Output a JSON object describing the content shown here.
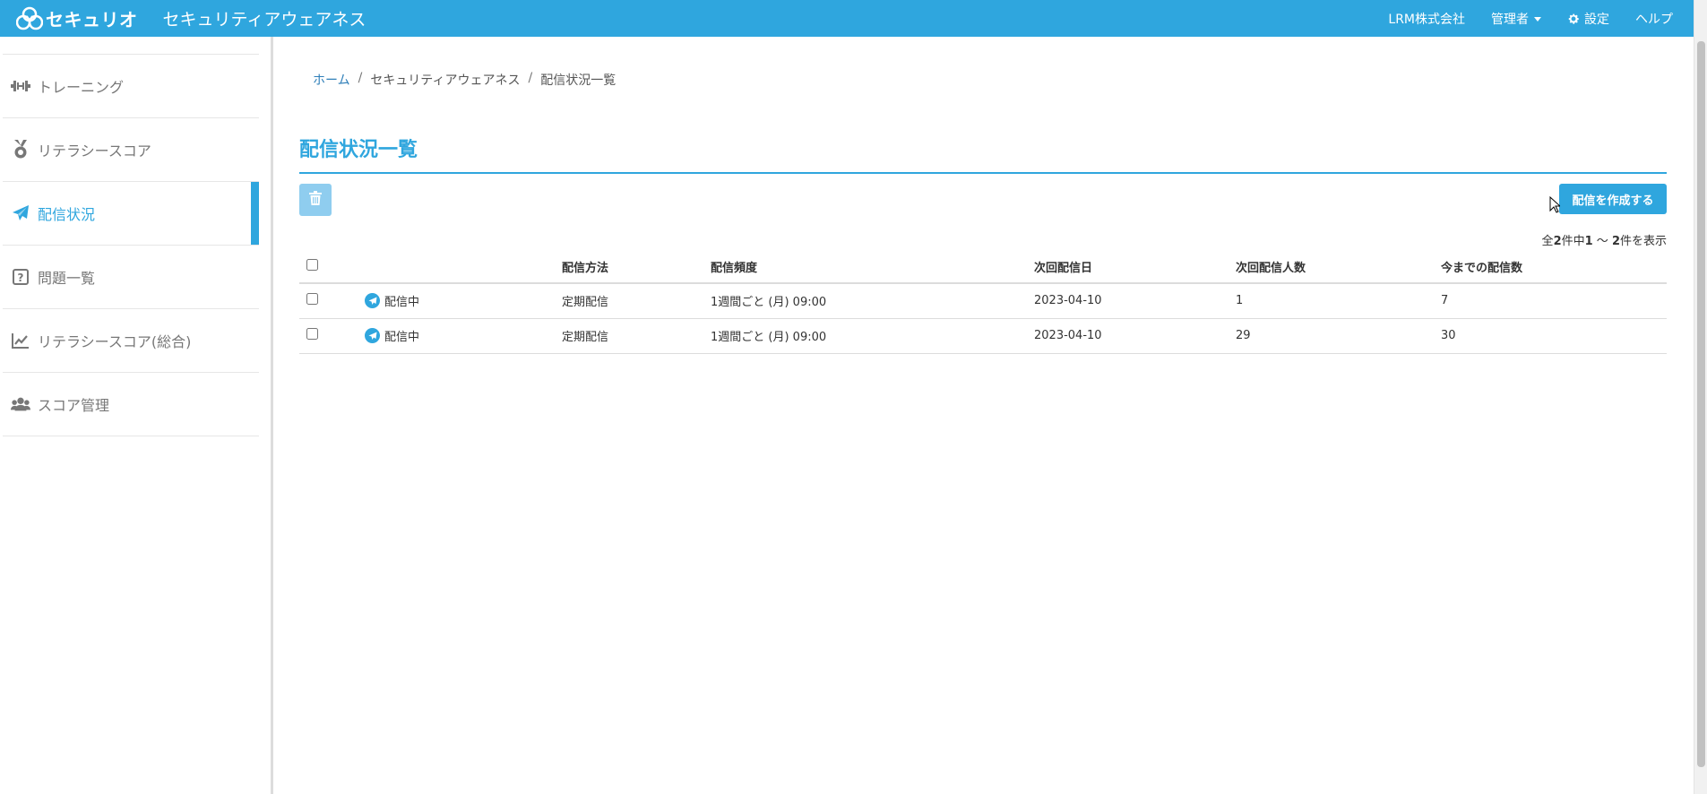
{
  "header": {
    "logo_text": "セキュリオ",
    "app_title": "セキュリティアウェアネス",
    "company": "LRM株式会社",
    "user_menu": "管理者",
    "settings": "設定",
    "help": "ヘルプ",
    "accent_color": "#2fa6de"
  },
  "sidebar": {
    "items": [
      {
        "label": "トレーニング",
        "icon": "dumbbell-icon"
      },
      {
        "label": "リテラシースコア",
        "icon": "medal-icon"
      },
      {
        "label": "配信状況",
        "icon": "paper-plane-icon",
        "active": true
      },
      {
        "label": "問題一覧",
        "icon": "question-square-icon"
      },
      {
        "label": "リテラシースコア(総合)",
        "icon": "chart-line-icon"
      },
      {
        "label": "スコア管理",
        "icon": "users-icon"
      }
    ]
  },
  "breadcrumb": {
    "home": "ホーム",
    "section": "セキュリティアウェアネス",
    "current": "配信状況一覧",
    "separator": "/"
  },
  "page": {
    "title": "配信状況一覧",
    "create_button": "配信を作成する",
    "count_prefix": "全",
    "count_total": "2",
    "count_mid1": "件中",
    "count_from": "1",
    "count_tilde": " 〜 ",
    "count_to": "2",
    "count_suffix": "件を表示"
  },
  "table": {
    "headers": [
      "",
      "",
      "配信方法",
      "配信頻度",
      "次回配信日",
      "次回配信人数",
      "今までの配信数"
    ],
    "rows": [
      {
        "status": "配信中",
        "method": "定期配信",
        "frequency": "1週間ごと (月) 09:00",
        "next_date": "2023-04-10",
        "next_count": "1",
        "total": "7"
      },
      {
        "status": "配信中",
        "method": "定期配信",
        "frequency": "1週間ごと (月) 09:00",
        "next_date": "2023-04-10",
        "next_count": "29",
        "total": "30"
      }
    ]
  }
}
